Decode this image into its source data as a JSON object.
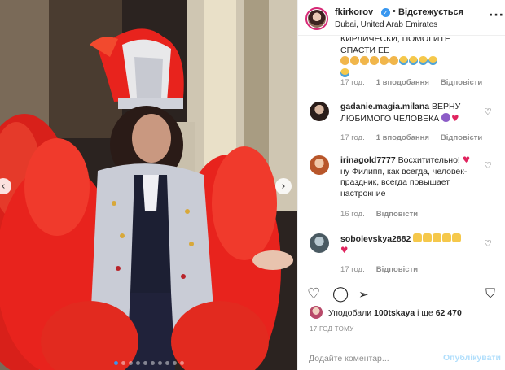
{
  "header": {
    "username": "fkirkorov",
    "separator": "•",
    "follow_label": "Відстежується",
    "location": "Dubai, United Arab Emirates",
    "more_icon": "more-horizontal-icon"
  },
  "comments": [
    {
      "username": "",
      "text_line1": "КИРЛИЧЕСКИ, ПОМОГИТЕ СПАСТИ ЕЕ",
      "text_line2": "ЕЕ",
      "time": "17 год.",
      "likes": "1 вподобання",
      "reply": "Відповісти"
    },
    {
      "username": "gadanie.magia.milana",
      "text": "ВЕРНУ ЛЮБИМОГО ЧЕЛОВЕКА",
      "time": "17 год.",
      "likes": "1 вподобання",
      "reply": "Відповісти"
    },
    {
      "username": "irinagold7777",
      "text": "Восхитительно!",
      "text_cont": "ну Филипп, как всегда, человек-праздник, всегда повышает настрокние",
      "time": "16 год.",
      "reply": "Відповісти"
    },
    {
      "username": "sobolevskya2882",
      "time": "17 год.",
      "reply": "Відповісти"
    }
  ],
  "actions": {
    "like_icon": "heart-icon",
    "comment_icon": "comment-icon",
    "share_icon": "send-icon",
    "save_icon": "bookmark-icon"
  },
  "likes": {
    "prefix": "Уподобали",
    "user": "100tskaya",
    "middle": "і ще",
    "count": "62 470"
  },
  "timestamp": "17 ГОД ТОМУ",
  "composer": {
    "placeholder": "Додайте коментар...",
    "post_label": "Опублікувати"
  },
  "media": {
    "prev_icon": "chevron-left-icon",
    "next_icon": "chevron-right-icon",
    "carousel_total": 10,
    "carousel_active": 1
  },
  "colors": {
    "accent": "#3897f0",
    "post_disabled": "#b2dffc",
    "meta_text": "#8e8e8e",
    "costume_red": "#e8231d"
  }
}
